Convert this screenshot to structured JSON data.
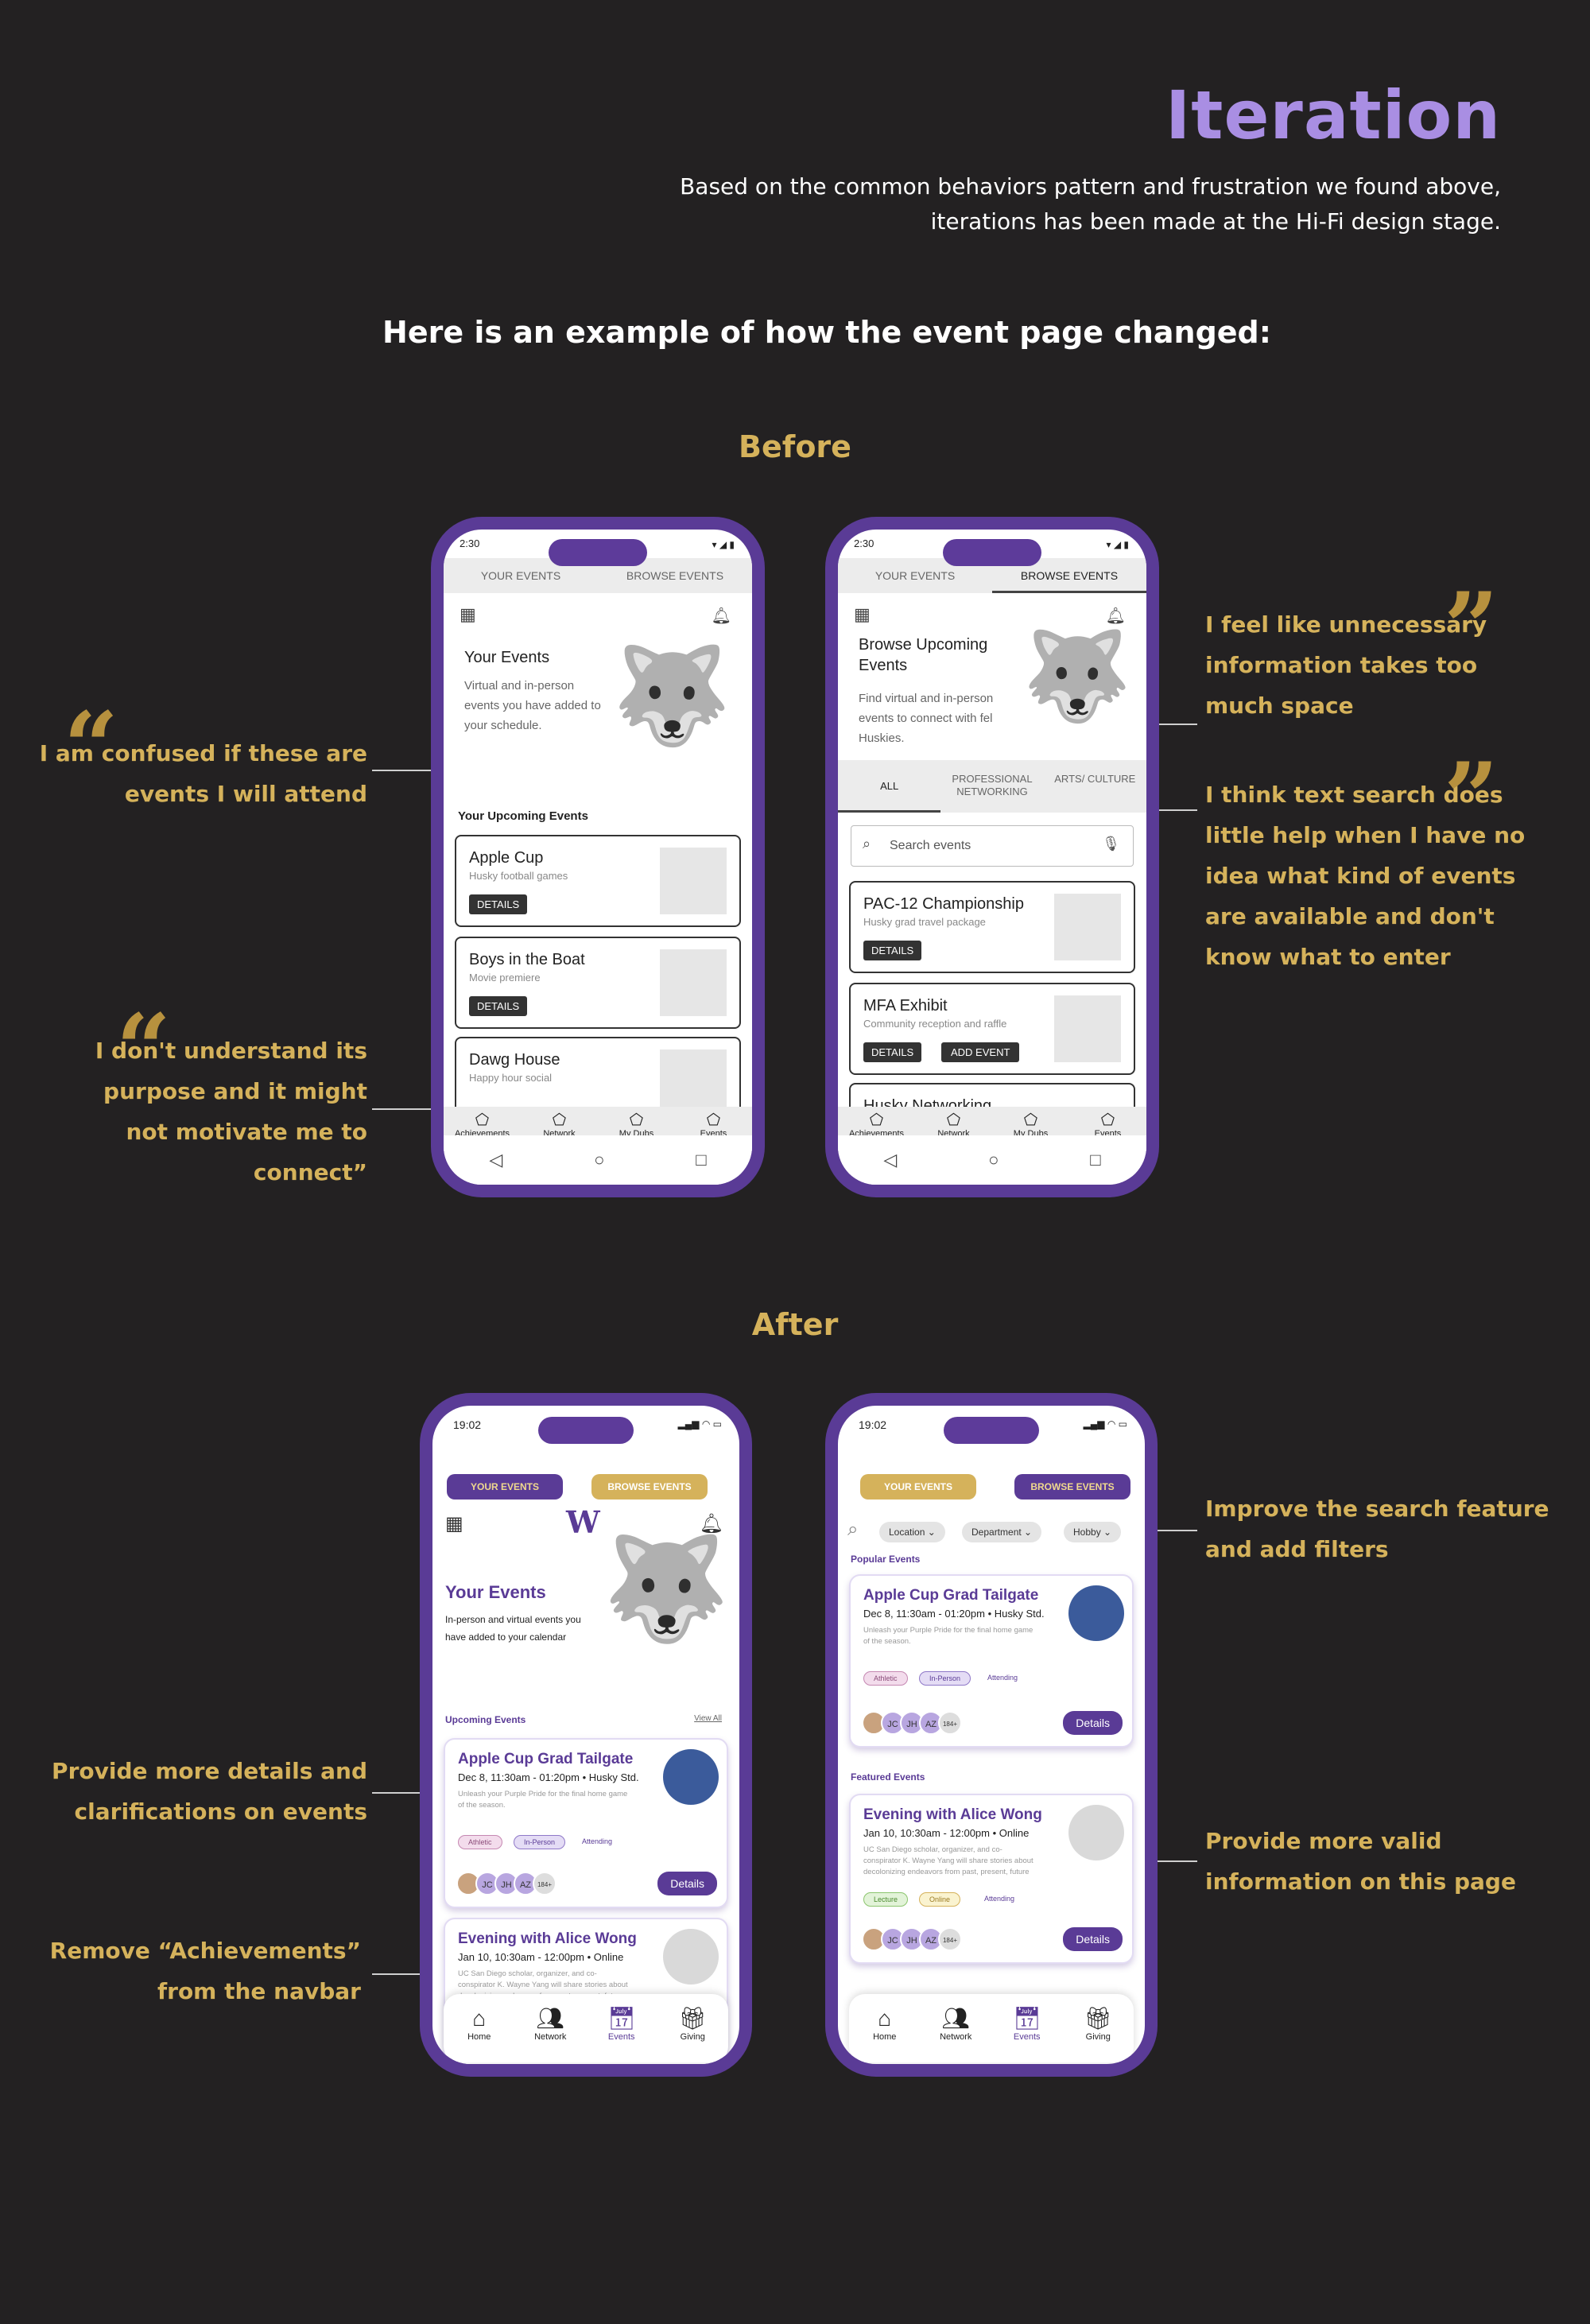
{
  "header": {
    "title": "Iteration",
    "intro_line1": "Based on the common behaviors pattern and frustration we found above,",
    "intro_line2": "iterations has been made at the Hi-Fi design stage.",
    "example": "Here is an example of how the event page changed:"
  },
  "sections": {
    "before": "Before",
    "after": "After"
  },
  "quotes": {
    "q1": [
      "I am confused if these are",
      "events I will attend"
    ],
    "q2": [
      "I don't understand its",
      "purpose and it might",
      "not motivate me to",
      "connect”"
    ],
    "q3": [
      "I feel like unnecessary",
      "information takes too",
      "much space"
    ],
    "q4": [
      "I think text search does",
      "little help when I have no",
      "idea what kind of events",
      "are available and don't",
      "know what to enter"
    ]
  },
  "notes": {
    "n1": [
      "Improve the search feature",
      "and add filters"
    ],
    "n2": [
      "Provide more details and",
      "clarifications on events"
    ],
    "n3": [
      "Provide more valid",
      "information on this page"
    ],
    "n4": [
      "Remove “Achievements”",
      "from the navbar"
    ]
  },
  "old_your": {
    "time": "2:30",
    "tab1": "YOUR EVENTS",
    "tab2": "BROWSE EVENTS",
    "hero_title": "Your Events",
    "hero_desc": "Virtual and in-person events you have added to your schedule.",
    "section": "Your Upcoming Events",
    "cards": [
      {
        "title": "Apple Cup",
        "sub": "Husky football games",
        "btn": "DETAILS"
      },
      {
        "title": "Boys in the Boat",
        "sub": "Movie premiere",
        "btn": "DETAILS"
      },
      {
        "title": "Dawg House",
        "sub": "Happy hour social",
        "btn": ""
      }
    ],
    "nav": [
      "Achievements",
      "Network",
      "My Dubs",
      "Events"
    ]
  },
  "old_browse": {
    "time": "2:30",
    "tab1": "YOUR EVENTS",
    "tab2": "BROWSE EVENTS",
    "hero_title": "Browse Upcoming Events",
    "hero_desc": "Find virtual and in-person events to connect with fel Huskies.",
    "filters": [
      "ALL",
      "PROFESSIONAL NETWORKING",
      "ARTS/ CULTURE"
    ],
    "search_placeholder": "Search events",
    "cards": [
      {
        "title": "PAC-12 Championship",
        "sub": "Husky grad travel package",
        "btn": "DETAILS",
        "btn2": ""
      },
      {
        "title": "MFA Exhibit",
        "sub": "Community reception and raffle",
        "btn": "DETAILS",
        "btn2": "ADD EVENT"
      },
      {
        "title": "Husky Networking",
        "sub": "",
        "btn": "",
        "btn2": ""
      }
    ],
    "nav": [
      "Achievements",
      "Network",
      "My Dubs",
      "Events"
    ]
  },
  "new_your": {
    "time": "19:02",
    "tab1": "YOUR EVENTS",
    "tab2": "BROWSE EVENTS",
    "logo": "W",
    "hero_title": "Your Events",
    "hero_desc": "In-person and virtual events you have added to your calendar",
    "section": "Upcoming Events",
    "view_all": "View All",
    "card1": {
      "title": "Apple Cup Grad Tailgate",
      "date": "Dec 8, 11:30am - 01:20pm • Husky Std.",
      "desc": "Unleash your Purple Pride for the final home game of the season.",
      "tags": [
        "Athletic",
        "In-Person",
        "Attending"
      ],
      "avatars": [
        "JC",
        "JH",
        "AZ",
        "184+"
      ],
      "btn": "Details"
    },
    "card2": {
      "title": "Evening with Alice Wong",
      "date": "Jan 10, 10:30am - 12:00pm • Online",
      "desc": "UC San Diego scholar, organizer, and co-conspirator K. Wayne Yang will share stories about decolonizing endeavors from past, present, future"
    },
    "nav": [
      "Home",
      "Network",
      "Events",
      "Giving"
    ]
  },
  "new_browse": {
    "time": "19:02",
    "tab1": "YOUR EVENTS",
    "tab2": "BROWSE EVENTS",
    "filters": [
      "Location",
      "Department",
      "Hobby"
    ],
    "popular": "Popular Events",
    "featured": "Featured Events",
    "card1": {
      "title": "Apple Cup Grad Tailgate",
      "date": "Dec 8, 11:30am - 01:20pm • Husky Std.",
      "desc": "Unleash your Purple Pride for the final home game of the season.",
      "tags": [
        "Athletic",
        "In-Person",
        "Attending"
      ],
      "avatars": [
        "JC",
        "JH",
        "AZ",
        "184+"
      ],
      "btn": "Details"
    },
    "card2": {
      "title": "Evening with Alice Wong",
      "date": "Jan 10, 10:30am - 12:00pm • Online",
      "desc": "UC San Diego scholar, organizer, and co-conspirator K. Wayne Yang will share stories about decolonizing endeavors from past, present, future",
      "tags": [
        "Lecture",
        "Online",
        "Attending"
      ],
      "avatars": [
        "JC",
        "JH",
        "AZ",
        "184+"
      ],
      "btn": "Details"
    },
    "nav": [
      "Home",
      "Network",
      "Events",
      "Giving"
    ]
  },
  "colors": {
    "bg": "#232122",
    "accent_purple": "#a98ee3",
    "gold": "#d5b25b",
    "brand_purple": "#5a3b96"
  }
}
